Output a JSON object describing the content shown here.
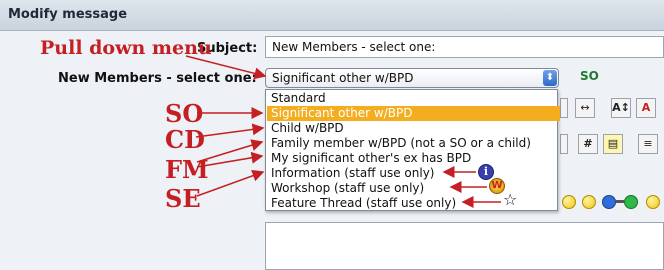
{
  "header": {
    "title": "Modify message"
  },
  "subject": {
    "label": "Subject:",
    "value": "New Members - select one:"
  },
  "select": {
    "label": "New Members - select one:",
    "value": "Significant other w/BPD",
    "options": [
      "Standard",
      "Significant other w/BPD",
      "Child w/BPD",
      "Family member w/BPD (not a SO or a child)",
      "My significant other's ex has BPD",
      "Information (staff use only)",
      "Workshop (staff use only)",
      "Feature Thread (staff use only)"
    ],
    "selected_index": 1
  },
  "status_code": "SO",
  "annotations": {
    "pull_down": "Pull down menu",
    "so": "SO",
    "cd": "CD",
    "fm": "FM",
    "se": "SE"
  },
  "icons": {
    "information": "i",
    "workshop": "W",
    "feature": "☆"
  },
  "toolbar": {
    "hr": "↔",
    "font_size": "A↕",
    "font_color": "A",
    "number": "#",
    "list": "≡",
    "quote": "▤"
  },
  "colors": {
    "selected_option": "#f4ad1f",
    "annotation": "#c42024",
    "so_code": "#1f7a2e"
  }
}
